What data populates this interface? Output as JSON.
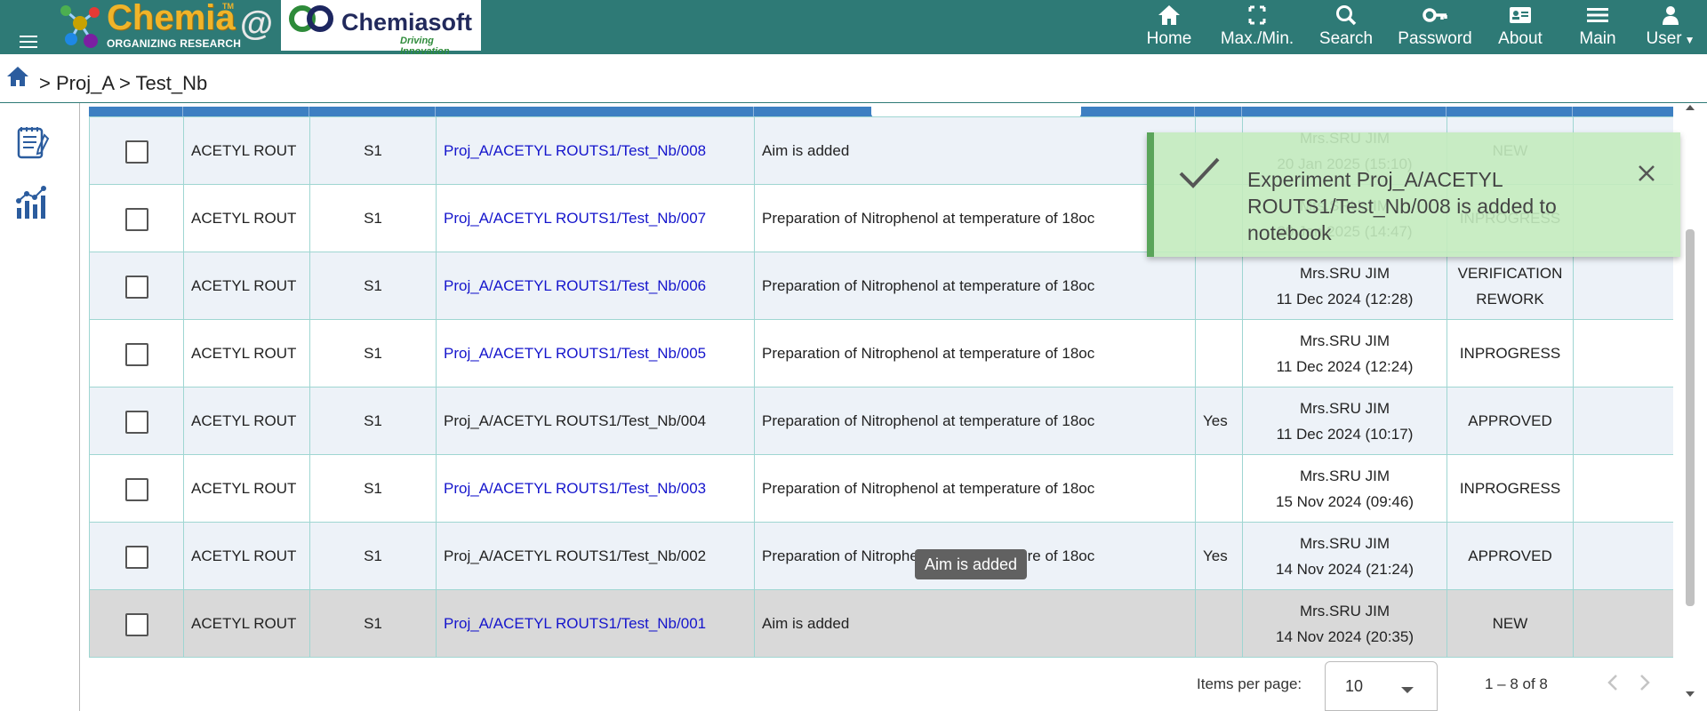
{
  "header": {
    "logo_name": "Chemia",
    "logo_tm": "TM",
    "logo_tagline": "ORGANIZING RESEARCH",
    "logo_at": "@",
    "partner_name": "Chemiasoft",
    "partner_tagline": "Driving Innovation",
    "nav": [
      {
        "label": "Home",
        "icon": "home-icon"
      },
      {
        "label": "Max./Min.",
        "icon": "fullscreen-icon"
      },
      {
        "label": "Search",
        "icon": "search-icon"
      },
      {
        "label": "Password",
        "icon": "key-icon"
      },
      {
        "label": "About",
        "icon": "id-card-icon"
      },
      {
        "label": "Main",
        "icon": "menu-icon"
      },
      {
        "label": "User",
        "icon": "user-icon"
      }
    ],
    "colors": {
      "bar": "#2e7a76",
      "brand_gold": "#f0b429"
    }
  },
  "breadcrumb": {
    "separator": ">",
    "items": [
      "Proj_A",
      "Test_Nb"
    ]
  },
  "sidebar": {
    "items": [
      {
        "icon": "notebook-icon"
      },
      {
        "icon": "chart-icon"
      }
    ]
  },
  "table": {
    "rows": [
      {
        "route": "ACETYL ROUT",
        "step": "S1",
        "experiment": "Proj_A/ACETYL ROUTS1/Test_Nb/008",
        "is_link": true,
        "aim": "Aim is added",
        "witnessed": "",
        "author": "Mrs.SRU JIM",
        "date": "20 Jan 2025 (15:10)",
        "status": "NEW",
        "selected": false
      },
      {
        "route": "ACETYL ROUT",
        "step": "S1",
        "experiment": "Proj_A/ACETYL ROUTS1/Test_Nb/007",
        "is_link": true,
        "aim": "Preparation of Nitrophenol at temperature of 18oc",
        "witnessed": "",
        "author": "Mrs.SRU JIM",
        "date": "20 Jan 2025 (14:47)",
        "status": "INPROGRESS",
        "selected": false
      },
      {
        "route": "ACETYL ROUT",
        "step": "S1",
        "experiment": "Proj_A/ACETYL ROUTS1/Test_Nb/006",
        "is_link": true,
        "aim": "Preparation of Nitrophenol at temperature of 18oc",
        "witnessed": "",
        "author": "Mrs.SRU JIM",
        "date": "11 Dec 2024 (12:28)",
        "status": "VERIFICATION REWORK",
        "selected": false
      },
      {
        "route": "ACETYL ROUT",
        "step": "S1",
        "experiment": "Proj_A/ACETYL ROUTS1/Test_Nb/005",
        "is_link": true,
        "aim": "Preparation of Nitrophenol at temperature of 18oc",
        "witnessed": "",
        "author": "Mrs.SRU JIM",
        "date": "11 Dec 2024 (12:24)",
        "status": "INPROGRESS",
        "selected": false
      },
      {
        "route": "ACETYL ROUT",
        "step": "S1",
        "experiment": "Proj_A/ACETYL ROUTS1/Test_Nb/004",
        "is_link": false,
        "aim": "Preparation of Nitrophenol at temperature of 18oc",
        "witnessed": "Yes",
        "author": "Mrs.SRU JIM",
        "date": "11 Dec 2024 (10:17)",
        "status": "APPROVED",
        "selected": false
      },
      {
        "route": "ACETYL ROUT",
        "step": "S1",
        "experiment": "Proj_A/ACETYL ROUTS1/Test_Nb/003",
        "is_link": true,
        "aim": "Preparation of Nitrophenol at temperature of 18oc",
        "witnessed": "",
        "author": "Mrs.SRU JIM",
        "date": "15 Nov 2024 (09:46)",
        "status": "INPROGRESS",
        "selected": false
      },
      {
        "route": "ACETYL ROUT",
        "step": "S1",
        "experiment": "Proj_A/ACETYL ROUTS1/Test_Nb/002",
        "is_link": false,
        "aim": "Preparation of Nitrophenol at temperature of 18oc",
        "witnessed": "Yes",
        "author": "Mrs.SRU JIM",
        "date": "14 Nov 2024 (21:24)",
        "status": "APPROVED",
        "selected": false
      },
      {
        "route": "ACETYL ROUT",
        "step": "S1",
        "experiment": "Proj_A/ACETYL ROUTS1/Test_Nb/001",
        "is_link": true,
        "aim": "Aim is added",
        "witnessed": "",
        "author": "Mrs.SRU JIM",
        "date": "14 Nov 2024 (20:35)",
        "status": "NEW",
        "selected": true
      }
    ],
    "colors": {
      "header_strip": "#3d7fc2",
      "link": "#1515cc",
      "row_alt": "#edf2f8",
      "row_selected": "#d9d9d9",
      "border": "#9fd6d2"
    }
  },
  "paginator": {
    "items_per_page_label": "Items per page:",
    "items_per_page_value": "10",
    "range_label": "1 – 8 of 8"
  },
  "tooltip": {
    "text": "Aim is added"
  },
  "toast": {
    "message": "Experiment Proj_A/ACETYL ROUTS1/Test_Nb/008 is added to notebook",
    "icon": "checkmark-icon",
    "close_icon": "close-icon",
    "colors": {
      "background": "#c3ebbe",
      "accent": "#5aa55a"
    }
  }
}
